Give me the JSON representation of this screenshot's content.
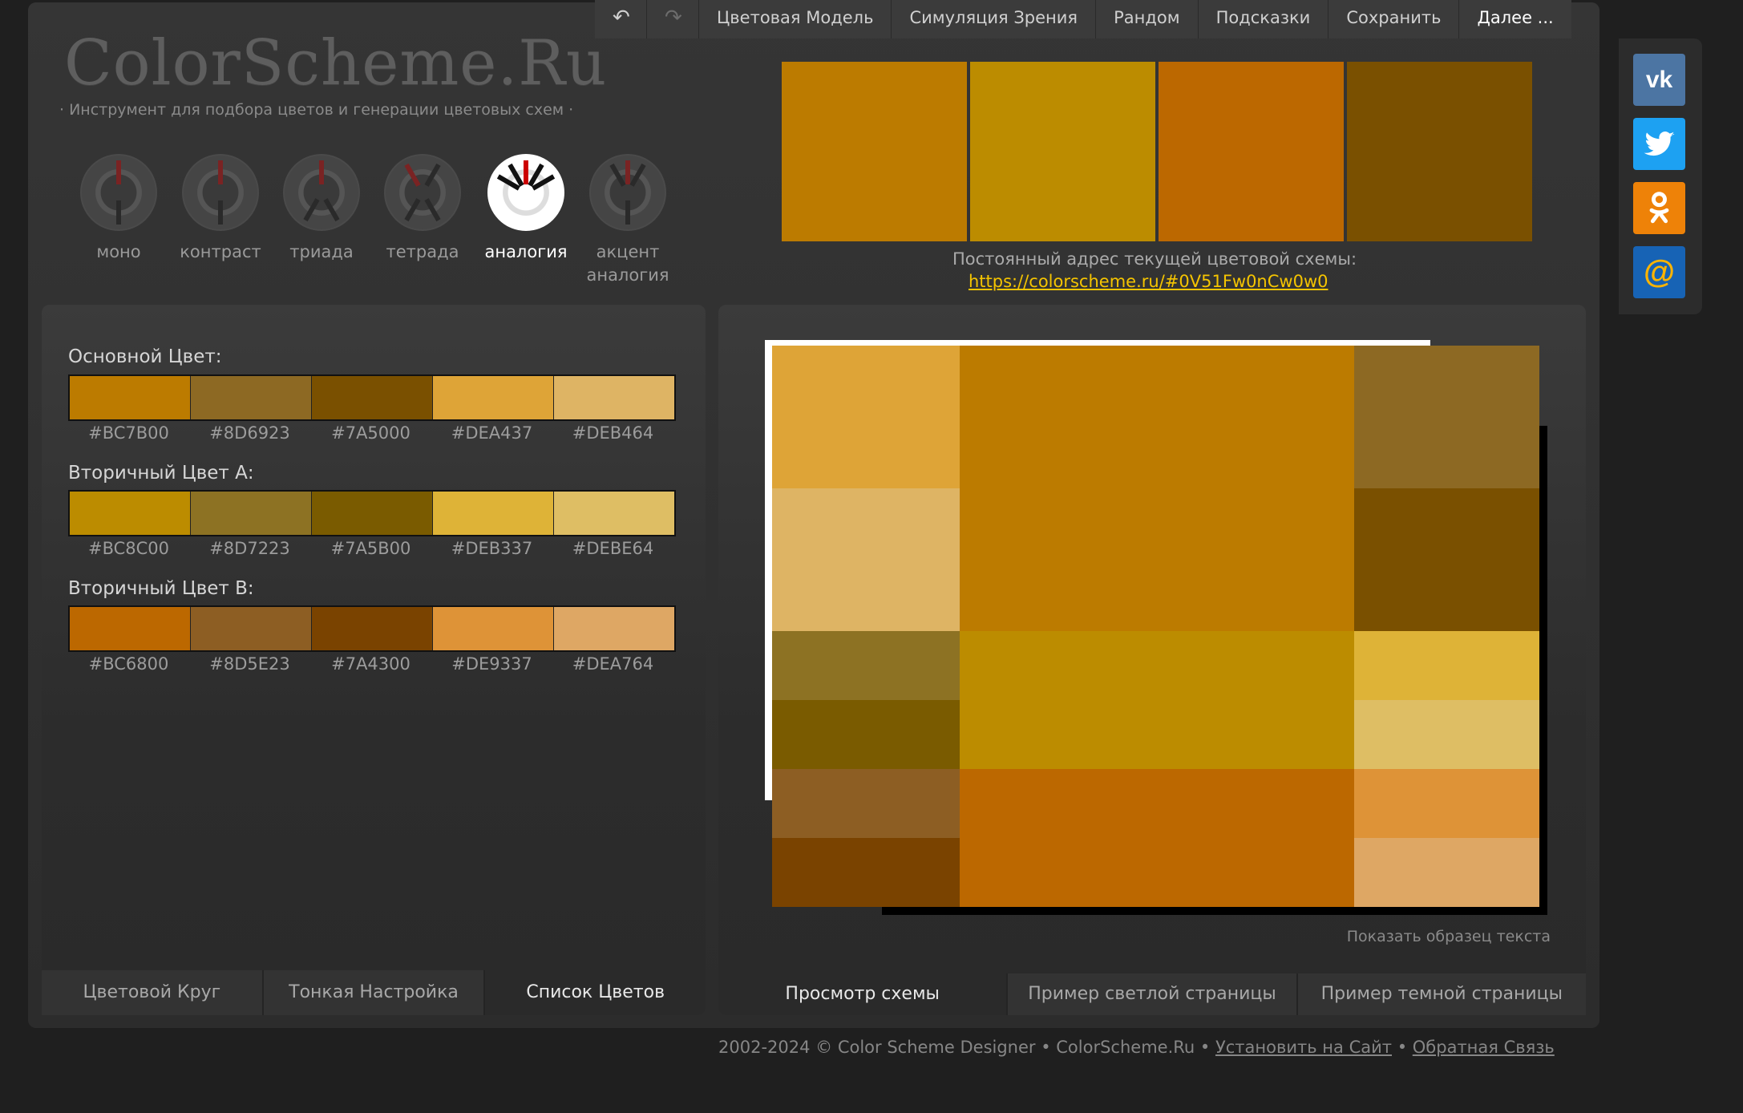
{
  "menu": {
    "undo_icon": "↶",
    "redo_icon": "↷",
    "items": [
      "Цветовая Модель",
      "Симуляция Зрения",
      "Рандом",
      "Подсказки",
      "Сохранить"
    ],
    "more": "Далее ..."
  },
  "header": {
    "logo": "ColorScheme.Ru",
    "tagline": "· Инструмент для подбора цветов и генерации цветовых схем ·"
  },
  "scheme_types": [
    {
      "label": "моно",
      "active": false
    },
    {
      "label": "контраст",
      "active": false
    },
    {
      "label": "триада",
      "active": false
    },
    {
      "label": "тетрада",
      "active": false
    },
    {
      "label": "аналогия",
      "active": true
    },
    {
      "label": "акцент аналогия",
      "active": false
    }
  ],
  "top_strip": [
    "#BC7B00",
    "#BC8C00",
    "#BC6800",
    "#7A5000"
  ],
  "permalink": {
    "label": "Постоянный адрес текущей цветовой схемы:",
    "url": "https://colorscheme.ru/#0V51Fw0nCw0w0"
  },
  "palette": {
    "primary": {
      "title": "Основной Цвет:",
      "colors": [
        "#BC7B00",
        "#8D6923",
        "#7A5000",
        "#DEA437",
        "#DEB464"
      ]
    },
    "secondary_a": {
      "title": "Вторичный Цвет А:",
      "colors": [
        "#BC8C00",
        "#8D7223",
        "#7A5B00",
        "#DEB337",
        "#DEBE64"
      ]
    },
    "secondary_b": {
      "title": "Вторичный Цвет B:",
      "colors": [
        "#BC6800",
        "#8D5E23",
        "#7A4300",
        "#DE9337",
        "#DEA764"
      ]
    }
  },
  "left_tabs": [
    "Цветовой Круг",
    "Тонкая Настройка",
    "Список Цветов"
  ],
  "right_tabs": [
    "Просмотр схемы",
    "Пример светлой страницы",
    "Пример темной страницы"
  ],
  "show_text": "Показать образец текста",
  "social": {
    "vk": "vk",
    "twitter": "twitter-icon",
    "ok": "ok-icon",
    "mail": "@"
  },
  "footer": {
    "copyright": "2002-2024 © Color Scheme Designer • ColorScheme.Ru •",
    "install": "Установить на Сайт",
    "sep": "•",
    "feedback": "Обратная Связь"
  }
}
